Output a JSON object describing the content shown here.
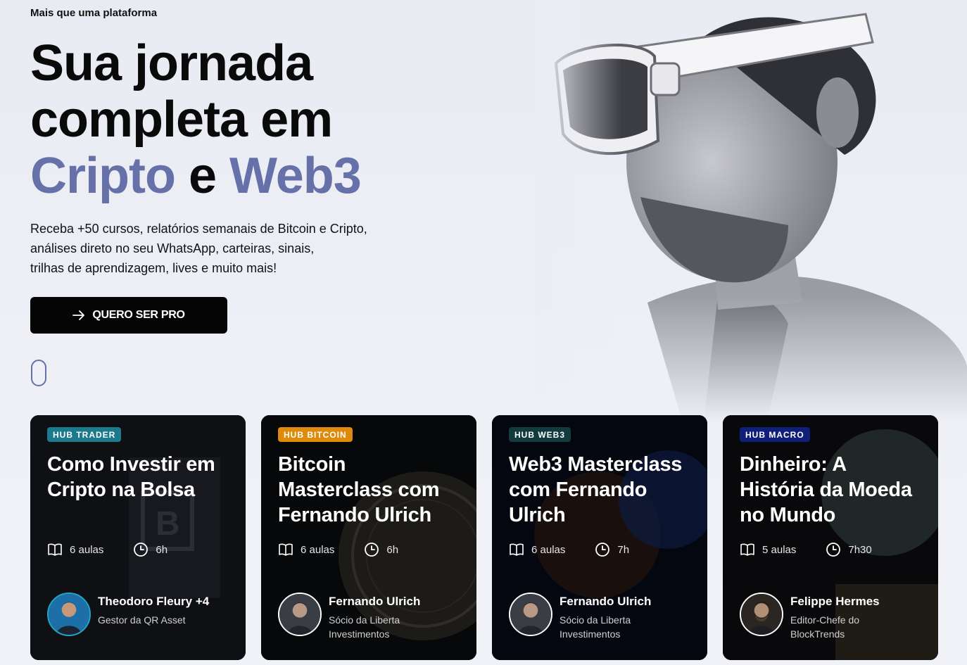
{
  "hero": {
    "eyebrow": "Mais que uma plataforma",
    "headline_line1": "Sua jornada",
    "headline_line2": "completa em",
    "headline_accent1": "Cripto",
    "headline_connector": " e ",
    "headline_accent2": "Web3",
    "subtitle_lines": [
      "Receba +50 cursos, relatórios semanais de Bitcoin e Cripto,",
      "análises direto no seu WhatsApp, carteiras, sinais,",
      "trilhas de aprendizagem, lives e muito mais!"
    ],
    "cta_label": "QUERO SER PRO",
    "accent_color": "#6571a8"
  },
  "cards": [
    {
      "badge": "HUB TRADER",
      "badge_color": "#1b7a8c",
      "title": "Como Investir em Cripto na Bolsa",
      "lessons": "6 aulas",
      "duration": "6h",
      "author_name": "Theodoro Fleury +4",
      "author_role": "Gestor da QR Asset",
      "avatar_ring": "#21a8c9"
    },
    {
      "badge": "HUB BITCOIN",
      "badge_color": "#e08a0b",
      "title": "Bitcoin Masterclass com Fernando Ulrich",
      "lessons": "6 aulas",
      "duration": "6h",
      "author_name": "Fernando Ulrich",
      "author_role": "Sócio da Liberta Investimentos",
      "avatar_ring": "#ffffff"
    },
    {
      "badge": "HUB WEB3",
      "badge_color": "#123b3f",
      "title": "Web3 Masterclass com Fernando Ulrich",
      "lessons": "6 aulas",
      "duration": "7h",
      "author_name": "Fernando Ulrich",
      "author_role": "Sócio da Liberta Investimentos",
      "avatar_ring": "#ffffff"
    },
    {
      "badge": "HUB MACRO",
      "badge_color": "#0f1f7a",
      "title": "Dinheiro: A História da Moeda no Mundo",
      "lessons": "5 aulas",
      "duration": "7h30",
      "author_name": "Felippe Hermes",
      "author_role": "Editor-Chefe do BlockTrends",
      "avatar_ring": "#ffffff"
    }
  ]
}
